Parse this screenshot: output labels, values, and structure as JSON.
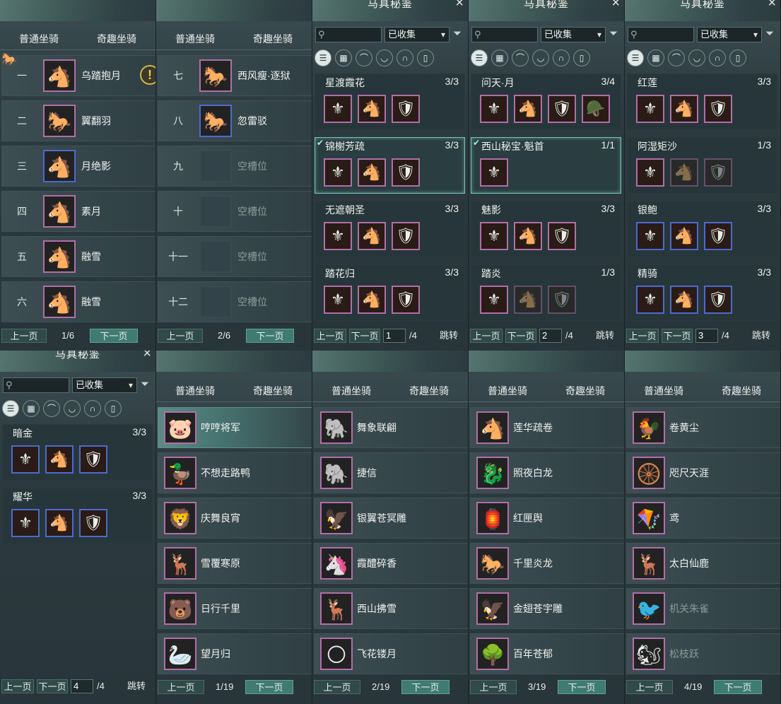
{
  "colors": {
    "accent": "#3f7b72",
    "rare_purple": "#b06fa8",
    "rare_blue": "#4c6ad0"
  },
  "common": {
    "tab_normal": "普通坐骑",
    "tab_fun": "奇趣坐骑",
    "prev": "上一页",
    "next": "下一页",
    "jump": "跳转",
    "codex_title": "马具秘鉴",
    "collected_filter": "已收集",
    "close_icon": "×",
    "search_icon": "magnifier-icon",
    "filter_icon": "funnel-icon"
  },
  "normal_pages": [
    {
      "page": "1/6",
      "rows": [
        {
          "num": "一",
          "name": "乌踏抱月",
          "icon": "white-horse-icon",
          "tier": "purple"
        },
        {
          "num": "二",
          "name": "翼翻羽",
          "icon": "black-horse-icon",
          "tier": "purple"
        },
        {
          "num": "三",
          "name": "月绝影",
          "icon": "white-horse-icon",
          "tier": "blue"
        },
        {
          "num": "四",
          "name": "素月",
          "icon": "white-horse-icon",
          "tier": "purple"
        },
        {
          "num": "五",
          "name": "融雪",
          "icon": "white-horse-icon",
          "tier": "purple"
        },
        {
          "num": "六",
          "name": "融雪",
          "icon": "white-horse-icon",
          "tier": "purple"
        }
      ]
    },
    {
      "page": "2/6",
      "rows": [
        {
          "num": "七",
          "name": "西风瘦·逐狱",
          "icon": "black-horse-icon",
          "tier": "purple"
        },
        {
          "num": "八",
          "name": "忽雷驳",
          "icon": "black-horse-icon",
          "tier": "blue"
        },
        {
          "num": "九",
          "name": "空槽位",
          "icon": "empty-slot-icon",
          "tier": "empty"
        },
        {
          "num": "十",
          "name": "空槽位",
          "icon": "empty-slot-icon",
          "tier": "empty"
        },
        {
          "num": "十一",
          "name": "空槽位",
          "icon": "empty-slot-icon",
          "tier": "empty"
        },
        {
          "num": "十二",
          "name": "空槽位",
          "icon": "empty-slot-icon",
          "tier": "empty"
        }
      ]
    }
  ],
  "codex_pages": [
    {
      "page_input": "1",
      "total": "/4",
      "sets": [
        {
          "name": "星渡霞花",
          "count": "3/3",
          "checked": false,
          "highlight": false,
          "tier": "purple",
          "pieces": 3
        },
        {
          "name": "锦榭芳疏",
          "count": "3/3",
          "checked": true,
          "highlight": true,
          "tier": "purple",
          "pieces": 3
        },
        {
          "name": "无遮朝圣",
          "count": "3/3",
          "checked": false,
          "highlight": false,
          "tier": "purple",
          "pieces": 3
        },
        {
          "name": "踏花归",
          "count": "3/3",
          "checked": false,
          "highlight": false,
          "tier": "purple",
          "pieces": 3
        }
      ]
    },
    {
      "page_input": "2",
      "total": "/4",
      "sets": [
        {
          "name": "问天·月",
          "count": "3/4",
          "checked": false,
          "highlight": false,
          "tier": "purple",
          "pieces": 4
        },
        {
          "name": "西山秘宝·魁首",
          "count": "1/1",
          "checked": true,
          "highlight": true,
          "tier": "purple",
          "pieces": 1
        },
        {
          "name": "魅影",
          "count": "3/3",
          "checked": false,
          "highlight": false,
          "tier": "purple",
          "pieces": 3
        },
        {
          "name": "踏炎",
          "count": "1/3",
          "checked": false,
          "highlight": false,
          "tier": "purple",
          "pieces": 3,
          "owned": 1
        }
      ]
    },
    {
      "page_input": "3",
      "total": "/4",
      "sets": [
        {
          "name": "红莲",
          "count": "3/3",
          "checked": false,
          "highlight": false,
          "tier": "purple",
          "pieces": 3
        },
        {
          "name": "阿湿矩沙",
          "count": "1/3",
          "checked": false,
          "highlight": false,
          "tier": "purple",
          "pieces": 3,
          "owned": 1
        },
        {
          "name": "银鲍",
          "count": "3/3",
          "checked": false,
          "highlight": false,
          "tier": "blue",
          "pieces": 3
        },
        {
          "name": "精骑",
          "count": "3/3",
          "checked": false,
          "highlight": false,
          "tier": "blue",
          "pieces": 3
        }
      ]
    },
    {
      "page_input": "4",
      "total": "/4",
      "sets": [
        {
          "name": "暗金",
          "count": "3/3",
          "checked": false,
          "highlight": false,
          "tier": "blue",
          "pieces": 3
        },
        {
          "name": "耀华",
          "count": "3/3",
          "checked": false,
          "highlight": false,
          "tier": "blue",
          "pieces": 3
        }
      ]
    }
  ],
  "fun_pages": [
    {
      "page": "1/19",
      "rows": [
        {
          "name": "哼哼将军",
          "icon": "pig-icon",
          "active": true,
          "dim": false
        },
        {
          "name": "不想走路鸭",
          "icon": "duck-icon",
          "active": false,
          "dim": false
        },
        {
          "name": "庆舞良宵",
          "icon": "lion-dance-icon",
          "active": false,
          "dim": false
        },
        {
          "name": "雪覆寒原",
          "icon": "white-deer-icon",
          "active": false,
          "dim": false
        },
        {
          "name": "日行千里",
          "icon": "bear-icon",
          "active": false,
          "dim": false
        },
        {
          "name": "望月归",
          "icon": "crane-icon",
          "active": false,
          "dim": false
        }
      ]
    },
    {
      "page": "2/19",
      "rows": [
        {
          "name": "舞象联翩",
          "icon": "elephant-icon",
          "active": false,
          "dim": false
        },
        {
          "name": "捷信",
          "icon": "white-elephant-icon",
          "active": false,
          "dim": false
        },
        {
          "name": "银翼苍冥雕",
          "icon": "eagle-icon",
          "active": false,
          "dim": false
        },
        {
          "name": "霞醴碎香",
          "icon": "unicorn-icon",
          "active": false,
          "dim": false
        },
        {
          "name": "西山拂雪",
          "icon": "white-deer-icon",
          "active": false,
          "dim": false
        },
        {
          "name": "飞花镂月",
          "icon": "golden-orb-icon",
          "active": false,
          "dim": false
        }
      ]
    },
    {
      "page": "3/19",
      "rows": [
        {
          "name": "莲华疏卷",
          "icon": "white-horse-icon",
          "active": false,
          "dim": false
        },
        {
          "name": "照夜白龙",
          "icon": "dragon-horse-icon",
          "active": false,
          "dim": false
        },
        {
          "name": "红匣舆",
          "icon": "palanquin-icon",
          "active": false,
          "dim": false
        },
        {
          "name": "千里炎龙",
          "icon": "fire-horse-icon",
          "active": false,
          "dim": false
        },
        {
          "name": "金翅苍宇雕",
          "icon": "golden-eagle-icon",
          "active": false,
          "dim": false
        },
        {
          "name": "百年苍郁",
          "icon": "tree-icon",
          "active": false,
          "dim": false
        }
      ]
    },
    {
      "page": "4/19",
      "rows": [
        {
          "name": "卷黄尘",
          "icon": "ostrich-icon",
          "active": false,
          "dim": false
        },
        {
          "name": "咫尺天涯",
          "icon": "tricycle-icon",
          "active": false,
          "dim": false
        },
        {
          "name": "鸢",
          "icon": "kite-hat-icon",
          "active": false,
          "dim": false
        },
        {
          "name": "太白仙鹿",
          "icon": "antler-deer-icon",
          "active": false,
          "dim": false
        },
        {
          "name": "机关朱雀",
          "icon": "mech-bird-icon",
          "active": false,
          "dim": true
        },
        {
          "name": "松枝跃",
          "icon": "squirrel-icon",
          "active": false,
          "dim": true
        }
      ]
    }
  ],
  "codex_cat_icons": [
    "list-icon",
    "grid-icon",
    "saddle-icon",
    "armor-icon",
    "horseshoe-icon",
    "stirrup-icon"
  ]
}
